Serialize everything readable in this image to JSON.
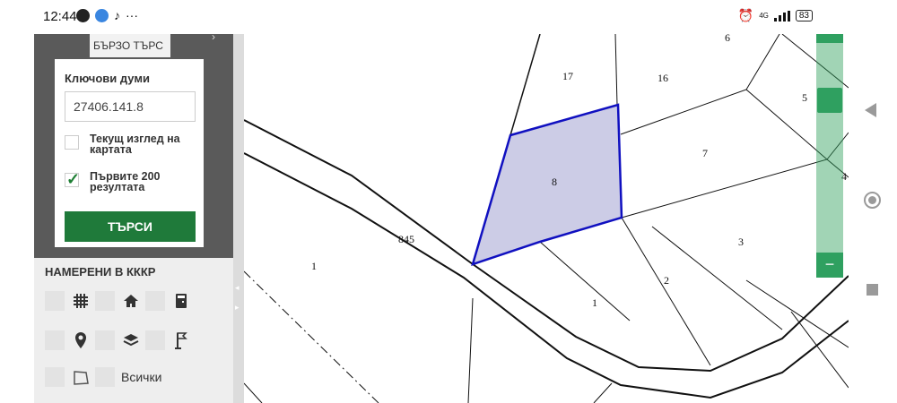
{
  "status_bar": {
    "time": "12:44",
    "dots": "···",
    "network": "4G",
    "battery": "83"
  },
  "sidebar": {
    "search_tab_label": "БЪРЗО ТЪРС",
    "keywords_label": "Ключови думи",
    "keywords_value": "27406.141.8",
    "option_current_view": "Текущ изглед на картата",
    "option_current_view_checked": false,
    "option_first_200": "Първите 200 резултата",
    "option_first_200_checked": true,
    "search_button": "ТЪРСИ",
    "found_title": "НАМЕРЕНИ В КККР",
    "found_icons": [
      "grid-icon",
      "home-icon",
      "calculator-icon",
      "location-pin-icon",
      "layers-icon",
      "flag-icon",
      "polygon-icon"
    ],
    "all_label": "Всички"
  },
  "map": {
    "selected_parcel": "8",
    "road_label": "845",
    "parcel_labels": [
      "6",
      "17",
      "16",
      "5",
      "7",
      "4",
      "8",
      "3",
      "1",
      "2",
      "1"
    ],
    "selected_fill": "#cccce6",
    "selected_stroke": "#1010c0"
  },
  "zoom": {
    "minus_label": "−"
  },
  "colors": {
    "accent_green": "#1f7a3a",
    "sidebar_dark": "#5a5a5a"
  }
}
